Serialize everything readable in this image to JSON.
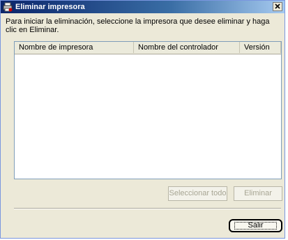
{
  "window": {
    "title": "Eliminar impresora",
    "accent_color": "#0a246a",
    "icons": {
      "app": "printer-delete-icon",
      "close": "close-icon"
    }
  },
  "instruction": "Para iniciar la eliminación, seleccione la impresora que desee eliminar y haga clic en Eliminar.",
  "printer_list": {
    "columns": [
      "Nombre de impresora",
      "Nombre del controlador",
      "Versión"
    ],
    "rows": []
  },
  "buttons": {
    "select_all": "Seleccionar todo",
    "delete": "Eliminar",
    "exit": "Salir"
  }
}
